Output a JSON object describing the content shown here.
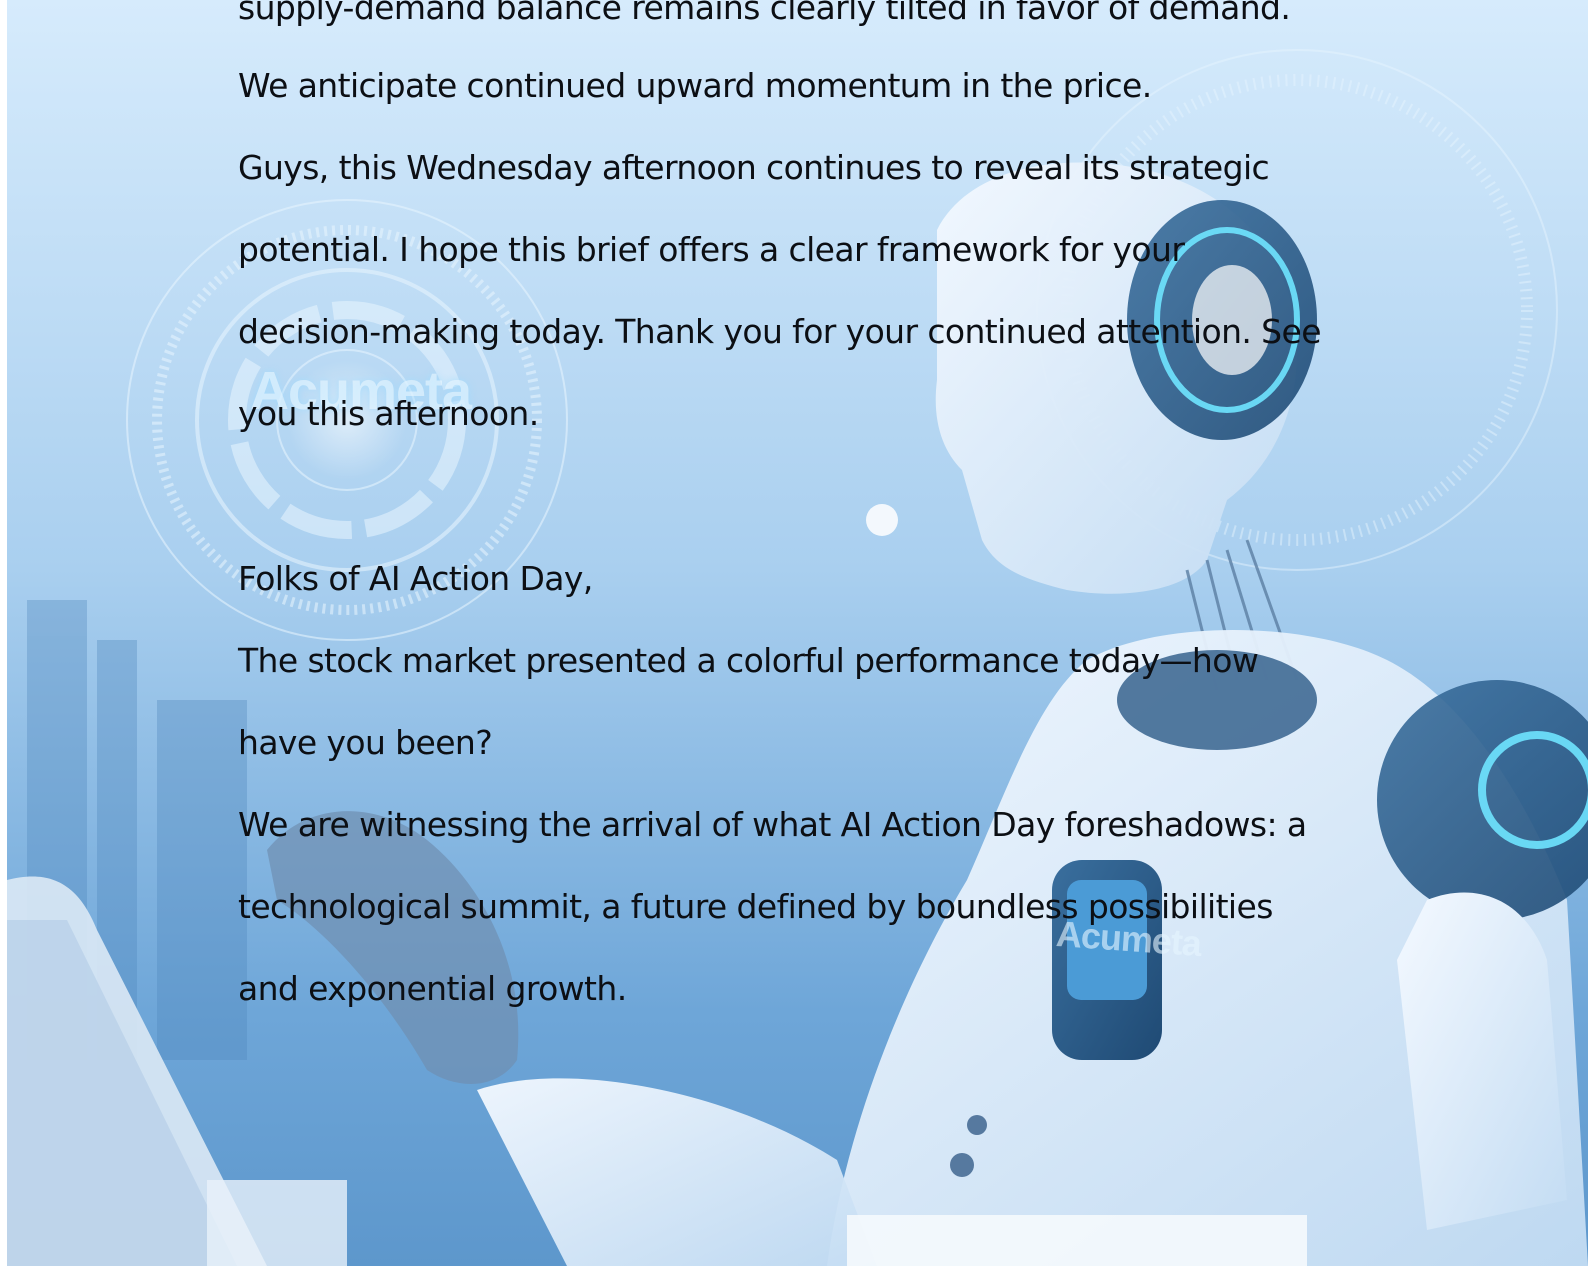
{
  "watermarks": {
    "left_logo": "Acumeta",
    "chest_logo": "Acumeta"
  },
  "colors": {
    "text": "#0c0f14",
    "background_light": "#cde6fb",
    "background_mid": "#7fb4e2",
    "background_dark": "#3f78ad"
  },
  "document": {
    "lines": [
      "supply-demand balance remains clearly tilted in favor of demand.",
      "We anticipate continued upward momentum in the price.",
      "Guys, this Wednesday afternoon continues to reveal its strategic",
      "potential. I hope this brief offers a clear framework for your",
      "decision-making today. Thank you for your continued attention. See",
      "you this afternoon.",
      "Folks of AI Action Day,",
      "The stock market presented a colorful performance today—how",
      "have you been?",
      "We are witnessing the arrival of what AI Action Day foreshadows: a",
      "technological summit, a future defined by boundless possibilities",
      "and exponential growth."
    ]
  }
}
